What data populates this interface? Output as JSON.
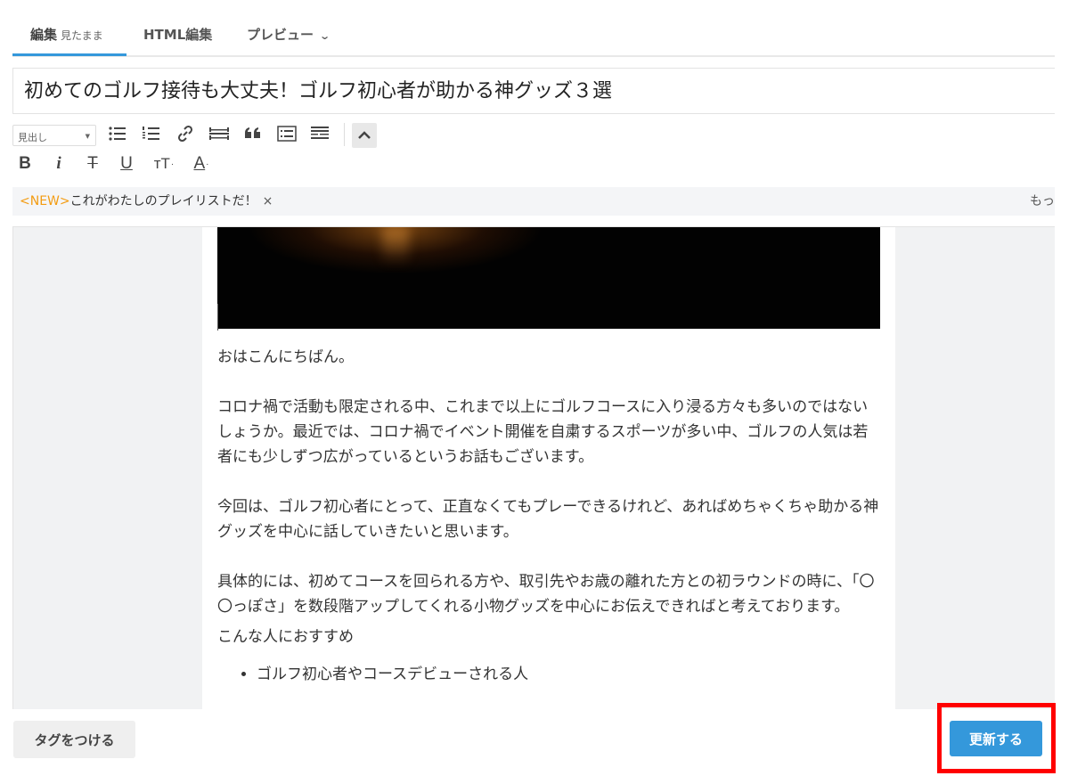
{
  "tabs": {
    "edit_label": "編集",
    "edit_sub": "見たまま",
    "html_label": "HTML編集",
    "preview_label": "プレビュー"
  },
  "title": {
    "value": "初めてのゴルフ接待も大丈夫！ゴルフ初心者が助かる神グッズ３選"
  },
  "toolbar": {
    "heading_select_value": "見出し",
    "bold": "B",
    "italic": "i",
    "strike": "T",
    "underline": "U",
    "text_size": "тT",
    "text_color": "A"
  },
  "notice": {
    "new_tag": "<NEW>",
    "text": "これがわたしのプレイリストだ！",
    "close": "×",
    "more": "もっ"
  },
  "article": {
    "p1": "おはこんにちばん。",
    "p2": "コロナ禍で活動も限定される中、これまで以上にゴルフコースに入り浸る方々も多いのではないしょうか。最近では、コロナ禍でイベント開催を自粛するスポーツが多い中、ゴルフの人気は若者にも少しずつ広がっているというお話もございます。",
    "p3": "今回は、ゴルフ初心者にとって、正直なくてもプレーできるけれど、あればめちゃくちゃ助かる神グッズを中心に話していきたいと思います。",
    "p4": "具体的には、初めてコースを回られる方や、取引先やお歳の離れた方との初ラウンドの時に、「〇〇っぽさ」を数段階アップしてくれる小物グッズを中心にお伝えできればと考えております。",
    "recommend_heading": "こんな人におすすめ",
    "list_items": [
      "ゴルフ初心者やコースデビューされる人"
    ]
  },
  "footer": {
    "tag_button": "タグをつける",
    "update_button": "更新する"
  },
  "colors": {
    "accent": "#3498db",
    "new_tag": "#f39c12",
    "highlight": "#ff0000"
  }
}
